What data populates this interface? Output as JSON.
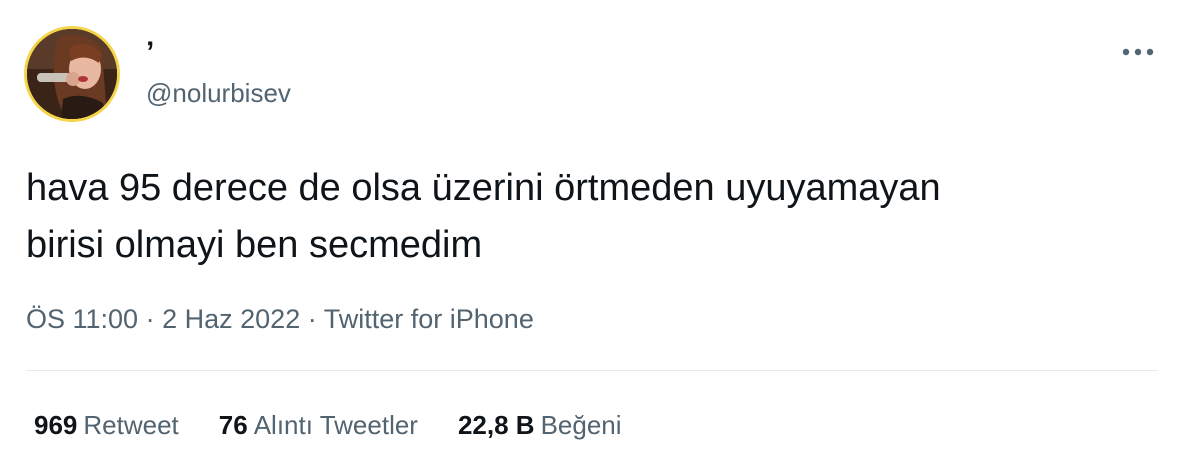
{
  "author": {
    "display_name": "’",
    "handle": "@nolurbisev",
    "avatar_border_color": "#f3d54a"
  },
  "tweet": {
    "text_line1": "hava 95 derece de olsa üzerini örtmeden uyuyamayan",
    "text_line2": "birisi olmayi ben secmedim"
  },
  "meta": {
    "time": "ÖS 11:00",
    "separator": "·",
    "date": "2 Haz 2022",
    "source": "Twitter for iPhone"
  },
  "stats": {
    "retweets_count": "969",
    "retweets_label": "Retweet",
    "quotes_count": "76",
    "quotes_label": "Alıntı Tweetler",
    "likes_count": "22,8 B",
    "likes_label": "Beğeni"
  },
  "icons": {
    "more": "more-horizontal-icon"
  }
}
